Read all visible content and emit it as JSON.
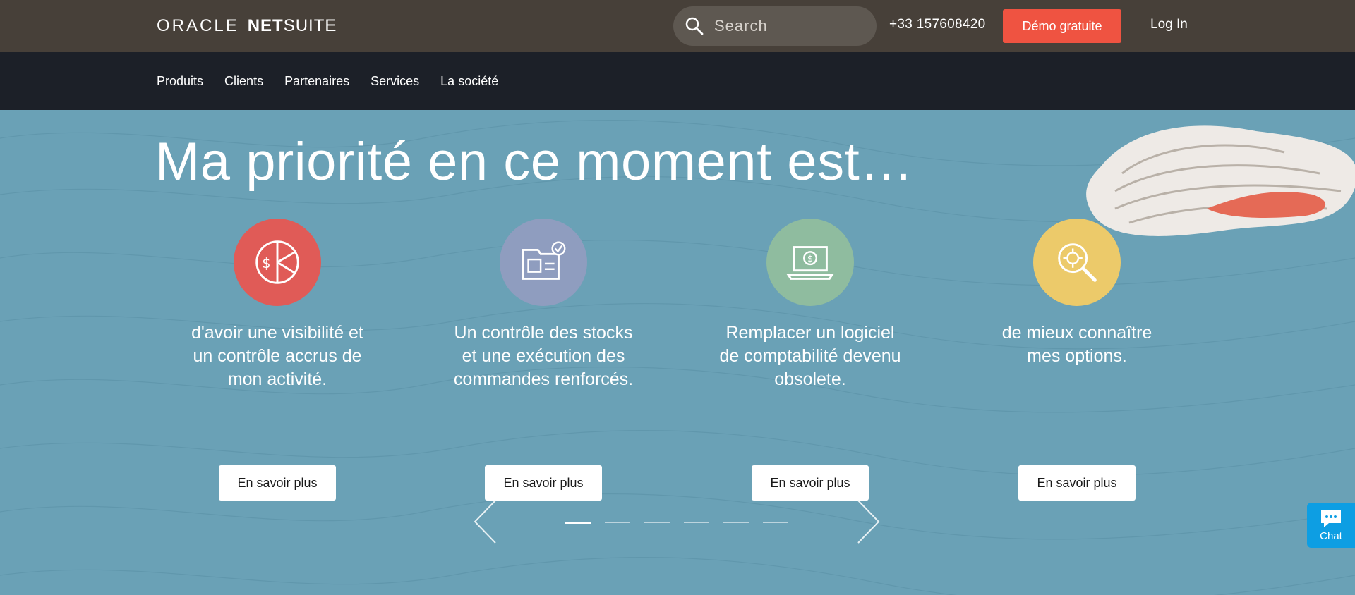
{
  "header": {
    "logo_oracle": "ORACLE",
    "logo_net": "NET",
    "logo_suite": "SUITE",
    "search_placeholder": "Search",
    "phone": "+33 157608420",
    "demo_label": "Démo gratuite",
    "login_label": "Log In"
  },
  "nav": {
    "items": [
      "Produits",
      "Clients",
      "Partenaires",
      "Services",
      "La société"
    ]
  },
  "hero": {
    "headline": "Ma priorité en ce moment est…",
    "cards": [
      {
        "text": "d'avoir une visibilité et un contrôle accrus de mon activité.",
        "button": "En savoir plus",
        "icon": "pie-chart-dollar-icon",
        "color": "#e05b57"
      },
      {
        "text": "Un contrôle des stocks et une exécution des commandes renforcés.",
        "button": "En savoir plus",
        "icon": "inventory-folder-icon",
        "color": "#8f9dbf"
      },
      {
        "text": "Remplacer un logiciel de comptabilité devenu obsolete.",
        "button": "En savoir plus",
        "icon": "laptop-dollar-icon",
        "color": "#8fbc9f"
      },
      {
        "text": "de mieux connaître mes options.",
        "button": "En savoir plus",
        "icon": "magnifier-target-icon",
        "color": "#ecca6a"
      }
    ],
    "carousel_slides": 6,
    "carousel_active": 1
  },
  "chat": {
    "label": "Chat"
  },
  "colors": {
    "topbar": "#474039",
    "navbar": "#1c2028",
    "hero": "#6aa1b6",
    "accent": "#ef5341",
    "chat": "#0d9ee3"
  }
}
